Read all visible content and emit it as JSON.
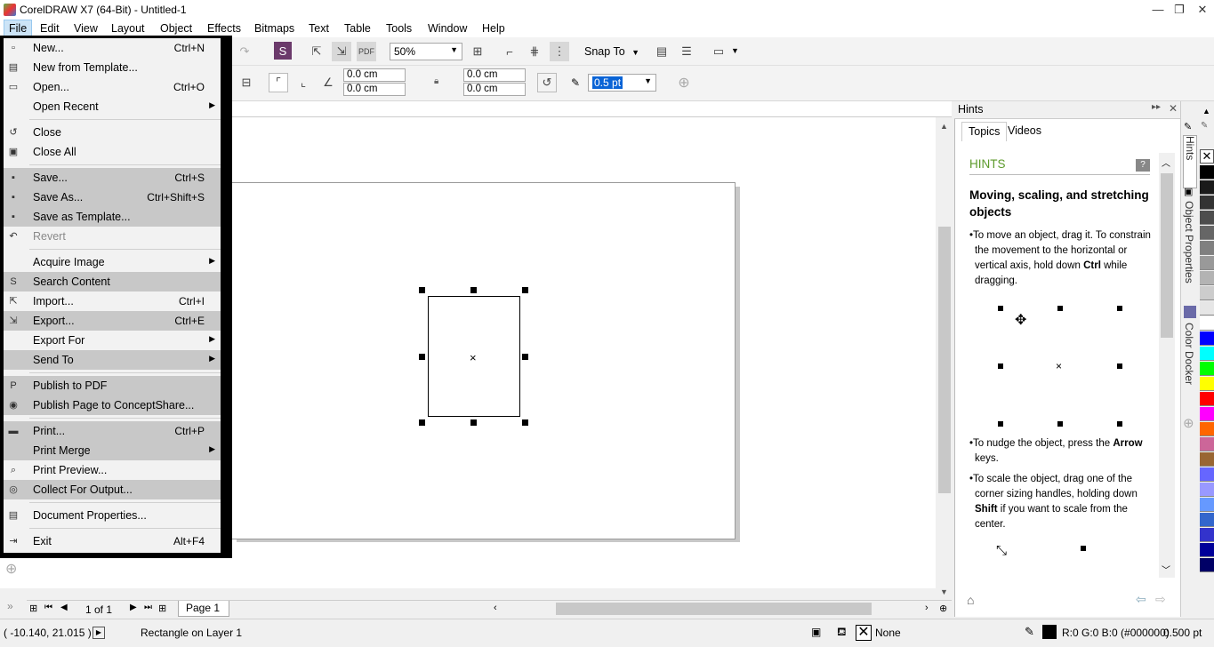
{
  "window": {
    "title": "CorelDRAW X7 (64-Bit) - Untitled-1",
    "minimize": "—",
    "restore": "❐",
    "close": "✕"
  },
  "menubar": [
    "File",
    "Edit",
    "View",
    "Layout",
    "Object",
    "Effects",
    "Bitmaps",
    "Text",
    "Table",
    "Tools",
    "Window",
    "Help"
  ],
  "toolbar": {
    "zoom_value": "50%",
    "snap_to": "Snap To",
    "pos_x": "0.0 cm",
    "pos_y": "0.0 cm",
    "size_w": "0.0 cm",
    "size_h": "0.0 cm",
    "outline_width": "0.5 pt"
  },
  "file_menu": [
    {
      "label": "New...",
      "shortcut": "Ctrl+N",
      "highlight": false,
      "icon": "new-document-icon"
    },
    {
      "label": "New from Template...",
      "shortcut": "",
      "highlight": false,
      "icon": "template-icon"
    },
    {
      "label": "Open...",
      "shortcut": "Ctrl+O",
      "highlight": false,
      "icon": "open-folder-icon"
    },
    {
      "label": "Open Recent",
      "shortcut": "",
      "submenu": true,
      "highlight": false,
      "icon": ""
    },
    {
      "sep": true
    },
    {
      "label": "Close",
      "shortcut": "",
      "highlight": false,
      "icon": "close-document-icon"
    },
    {
      "label": "Close All",
      "shortcut": "",
      "highlight": false,
      "icon": "close-all-icon"
    },
    {
      "sep": true
    },
    {
      "label": "Save...",
      "shortcut": "Ctrl+S",
      "highlight": true,
      "icon": "save-icon"
    },
    {
      "label": "Save As...",
      "shortcut": "Ctrl+Shift+S",
      "highlight": true,
      "icon": "save-as-icon"
    },
    {
      "label": "Save as Template...",
      "shortcut": "",
      "highlight": true,
      "icon": "save-template-icon"
    },
    {
      "label": "Revert",
      "shortcut": "",
      "highlight": false,
      "disabled": true,
      "icon": "revert-icon"
    },
    {
      "sep": true
    },
    {
      "label": "Acquire Image",
      "shortcut": "",
      "submenu": true,
      "highlight": false,
      "icon": ""
    },
    {
      "label": "Search Content",
      "shortcut": "",
      "highlight": true,
      "icon": "search-content-icon"
    },
    {
      "label": "Import...",
      "shortcut": "Ctrl+I",
      "highlight": false,
      "icon": "import-icon"
    },
    {
      "label": "Export...",
      "shortcut": "Ctrl+E",
      "highlight": true,
      "icon": "export-icon"
    },
    {
      "label": "Export For",
      "shortcut": "",
      "submenu": true,
      "highlight": false,
      "icon": ""
    },
    {
      "label": "Send To",
      "shortcut": "",
      "submenu": true,
      "highlight": true,
      "icon": ""
    },
    {
      "sep": true
    },
    {
      "label": "Publish to PDF",
      "shortcut": "",
      "highlight": true,
      "icon": "pdf-icon"
    },
    {
      "label": "Publish Page to ConceptShare...",
      "shortcut": "",
      "highlight": true,
      "icon": "conceptshare-icon"
    },
    {
      "sep": true
    },
    {
      "label": "Print...",
      "shortcut": "Ctrl+P",
      "highlight": true,
      "icon": "print-icon"
    },
    {
      "label": "Print Merge",
      "shortcut": "",
      "submenu": true,
      "highlight": true,
      "icon": ""
    },
    {
      "label": "Print Preview...",
      "shortcut": "",
      "highlight": false,
      "icon": "print-preview-icon"
    },
    {
      "label": "Collect For Output...",
      "shortcut": "",
      "highlight": true,
      "icon": "collect-output-icon"
    },
    {
      "sep": true
    },
    {
      "label": "Document Properties...",
      "shortcut": "",
      "highlight": false,
      "icon": "document-properties-icon"
    },
    {
      "sep": true
    },
    {
      "label": "Exit",
      "shortcut": "Alt+F4",
      "highlight": false,
      "icon": "exit-icon"
    }
  ],
  "hints": {
    "panel_title": "Hints",
    "tab_topics": "Topics",
    "tab_videos": "Videos",
    "heading": "HINTS",
    "subheading": "Moving, scaling, and stretching objects",
    "p1_pre": "To move an object, drag it. To constrain the movement to the horizontal or vertical axis, hold down ",
    "p1_bold": "Ctrl",
    "p1_post": " while dragging.",
    "p2_pre": "To nudge the object, press the ",
    "p2_bold": "Arrow",
    "p2_post": " keys.",
    "p3_pre": "To scale the object, drag one of the corner sizing handles, holding down ",
    "p3_bold": "Shift",
    "p3_post": " if you want to scale from the center."
  },
  "side_tabs": {
    "hints": "Hints",
    "object_properties": "Object Properties",
    "color_docker": "Color Docker"
  },
  "page_nav": {
    "counter": "1 of 1",
    "page_tab": "Page 1"
  },
  "status": {
    "coords": "( -10.140, 21.015 )",
    "object": "Rectangle on Layer 1",
    "fill": "None",
    "outline_color": "R:0 G:0 B:0 (#000000)",
    "outline_width": "0.500 pt"
  },
  "palette": [
    "#000000",
    "#1a1a1a",
    "#333333",
    "#4d4d4d",
    "#666666",
    "#808080",
    "#999999",
    "#b3b3b3",
    "#cccccc",
    "#e6e6e6",
    "#ffffff",
    "#0000ff",
    "#00ffff",
    "#00ff00",
    "#ffff00",
    "#ff0000",
    "#ff00ff",
    "#ff6600",
    "#cc6699",
    "#996633",
    "#6666ff",
    "#9999ff",
    "#6699ff",
    "#3366cc",
    "#3333cc",
    "#000099",
    "#000066"
  ]
}
